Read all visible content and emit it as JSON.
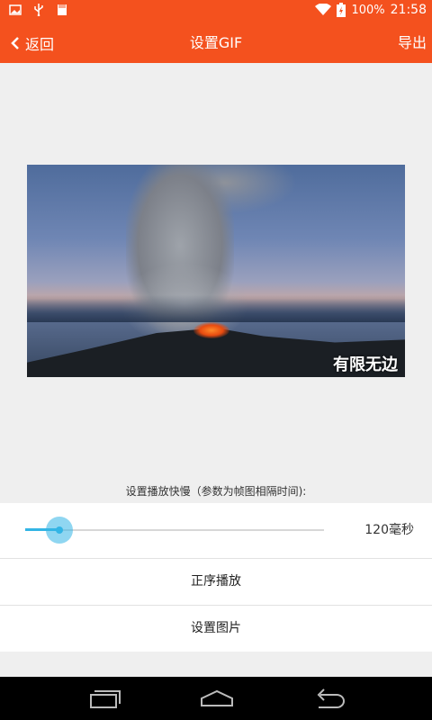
{
  "status_bar": {
    "battery": "100%",
    "time": "21:58",
    "icons": [
      "image-icon",
      "usb-icon",
      "sd-card-icon",
      "wifi-icon",
      "battery-charging-icon"
    ]
  },
  "app_bar": {
    "back_label": "返回",
    "title": "设置GIF",
    "export_label": "导出",
    "color": "#f4511e"
  },
  "preview": {
    "caption": "有限无边"
  },
  "controls": {
    "hint": "设置播放快慢（参数为帧图相隔时间):",
    "speed_value": "120毫秒",
    "slider_accent": "#33b5e5",
    "order_label": "正序播放",
    "set_image_label": "设置图片"
  },
  "nav_bar": {
    "buttons": [
      "recent-apps-icon",
      "home-icon",
      "back-nav-icon"
    ]
  }
}
